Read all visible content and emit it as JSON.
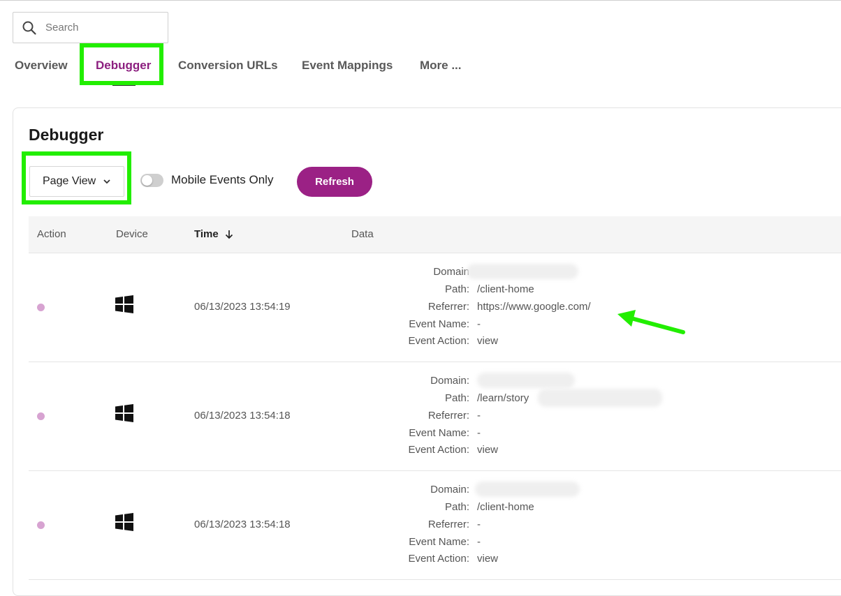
{
  "search": {
    "placeholder": "Search"
  },
  "tabs": [
    {
      "label": "Overview"
    },
    {
      "label": "Debugger",
      "active": true
    },
    {
      "label": "Conversion URLs"
    },
    {
      "label": "Event Mappings"
    },
    {
      "label": "More ..."
    }
  ],
  "debugger": {
    "title": "Debugger",
    "dropdown_value": "Page View",
    "toggle_label": "Mobile Events Only",
    "toggle_on": false,
    "refresh_label": "Refresh"
  },
  "table": {
    "headers": [
      "Action",
      "Device",
      "Time",
      "Data"
    ],
    "sort_column": "Time",
    "rows": [
      {
        "device": "windows-icon",
        "time": "06/13/2023 13:54:19",
        "data": [
          {
            "key": "Domain",
            "value": ""
          },
          {
            "key": "Path:",
            "value": "/client-home"
          },
          {
            "key": "Referrer:",
            "value": "https://www.google.com/"
          },
          {
            "key": "Event Name:",
            "value": "-"
          },
          {
            "key": "Event Action:",
            "value": "view"
          }
        ]
      },
      {
        "device": "windows-icon",
        "time": "06/13/2023 13:54:18",
        "data": [
          {
            "key": "Domain:",
            "value": ""
          },
          {
            "key": "Path:",
            "value": "/learn/story"
          },
          {
            "key": "Referrer:",
            "value": "-"
          },
          {
            "key": "Event Name:",
            "value": "-"
          },
          {
            "key": "Event Action:",
            "value": "view"
          }
        ]
      },
      {
        "device": "windows-icon",
        "time": "06/13/2023 13:54:18",
        "data": [
          {
            "key": "Domain:",
            "value": ""
          },
          {
            "key": "Path:",
            "value": "/client-home"
          },
          {
            "key": "Referrer:",
            "value": "-"
          },
          {
            "key": "Event Name:",
            "value": "-"
          },
          {
            "key": "Event Action:",
            "value": "view"
          }
        ]
      }
    ]
  },
  "colors": {
    "accent": "#9b2185",
    "active_tab": "#8c1f7f",
    "highlight": "#22ee00",
    "status_dot": "#d7a3d1"
  }
}
